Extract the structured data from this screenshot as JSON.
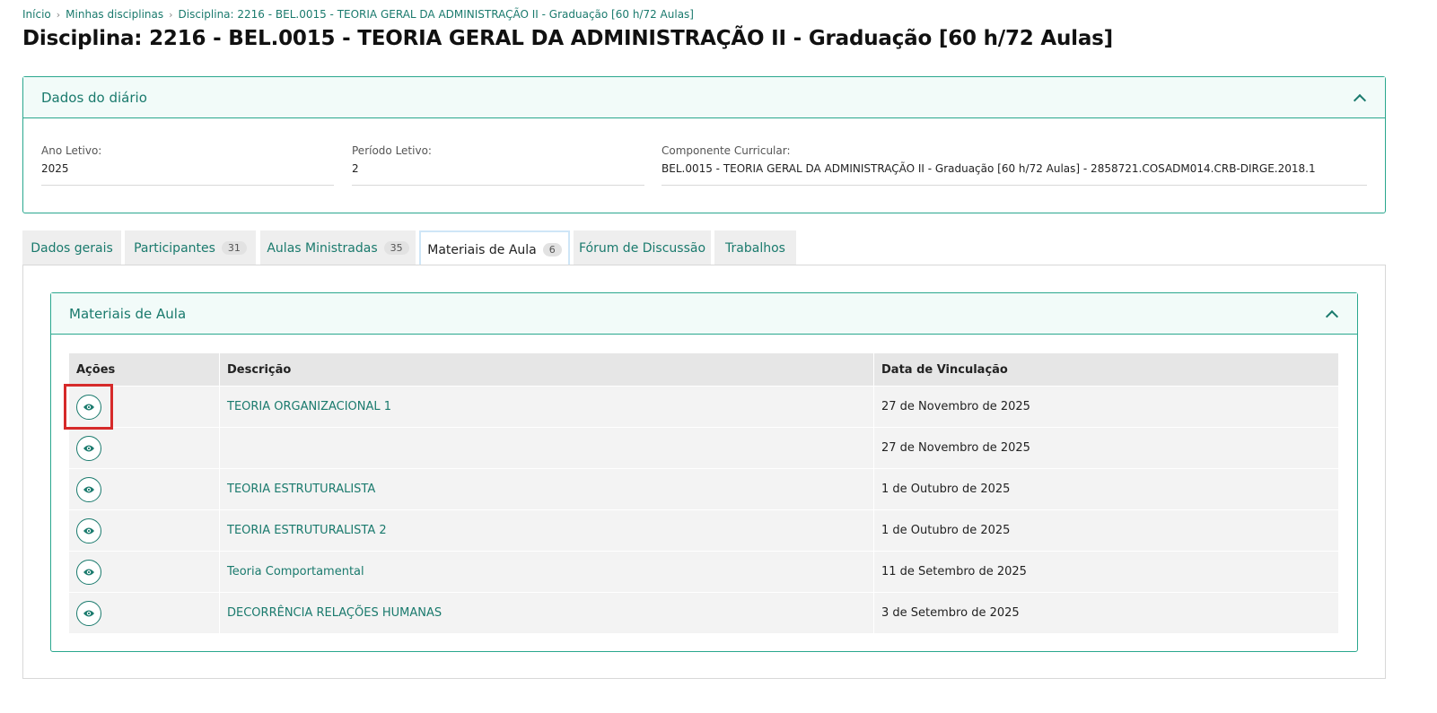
{
  "breadcrumb": {
    "items": [
      "Início",
      "Minhas disciplinas",
      "Disciplina: 2216 - BEL.0015 - TEORIA GERAL DA ADMINISTRAÇÃO II - Graduação [60 h/72 Aulas]"
    ],
    "separator": "›"
  },
  "page_title": "Disciplina: 2216 - BEL.0015 - TEORIA GERAL DA ADMINISTRAÇÃO II - Graduação [60 h/72 Aulas]",
  "diario": {
    "title": "Dados do diário",
    "fields": [
      {
        "label": "Ano Letivo:",
        "value": "2025"
      },
      {
        "label": "Período Letivo:",
        "value": "2"
      },
      {
        "label": "Componente Curricular:",
        "value": "BEL.0015 - TEORIA GERAL DA ADMINISTRAÇÃO II - Graduação [60 h/72 Aulas] - 2858721.COSADM014.CRB-DIRGE.2018.1"
      }
    ]
  },
  "tabs": [
    {
      "label": "Dados gerais",
      "count": null
    },
    {
      "label": "Participantes",
      "count": "31"
    },
    {
      "label": "Aulas Ministradas",
      "count": "35"
    },
    {
      "label": "Materiais de Aula",
      "count": "6",
      "active": true
    },
    {
      "label": "Fórum de Discussão",
      "count": null
    },
    {
      "label": "Trabalhos",
      "count": null
    }
  ],
  "materiais": {
    "title": "Materiais de Aula",
    "columns": [
      "Ações",
      "Descrição",
      "Data de Vinculação"
    ],
    "rows": [
      {
        "descricao": "TEORIA ORGANIZACIONAL 1",
        "data": "27 de Novembro de 2025"
      },
      {
        "descricao": "",
        "data": "27 de Novembro de 2025"
      },
      {
        "descricao": "TEORIA ESTRUTURALISTA",
        "data": "1 de Outubro de 2025"
      },
      {
        "descricao": "TEORIA ESTRUTURALISTA 2",
        "data": "1 de Outubro de 2025"
      },
      {
        "descricao": "Teoria Comportamental",
        "data": "11 de Setembro de 2025"
      },
      {
        "descricao": "DECORRÊNCIA RELAÇÕES HUMANAS",
        "data": "3 de Setembro de 2025"
      }
    ]
  },
  "icons": {
    "row_action": "eye-icon",
    "collapse": "chevron-up-icon",
    "crumb_separator": "chevron-right-icon"
  },
  "colors": {
    "accent": "#1a7a6d",
    "border": "#2aa78e",
    "highlight": "#d62a2a"
  }
}
